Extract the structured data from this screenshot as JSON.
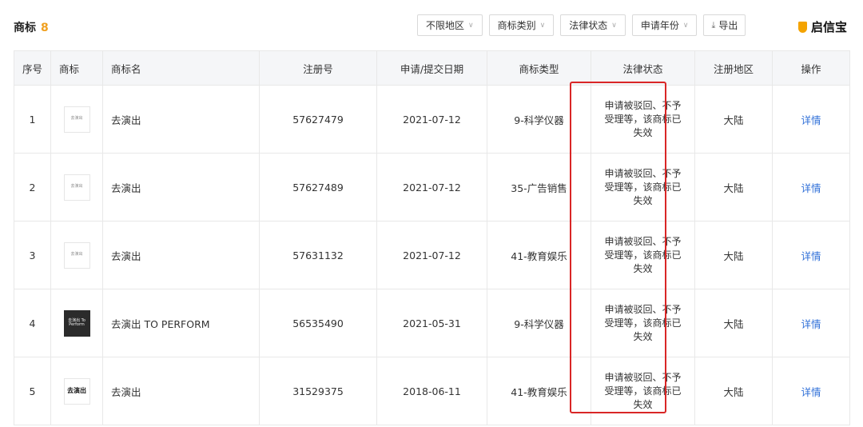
{
  "header": {
    "title": "商标",
    "count": "8",
    "filters": [
      "不限地区",
      "商标类别",
      "法律状态",
      "申请年份"
    ],
    "export_label": "导出",
    "brand_name": "启信宝"
  },
  "table": {
    "columns": [
      "序号",
      "商标",
      "商标名",
      "注册号",
      "申请/提交日期",
      "商标类型",
      "法律状态",
      "注册地区",
      "操作"
    ],
    "rows": [
      {
        "no": "1",
        "logo_text": "去演出",
        "name": "去演出",
        "reg_no": "57627479",
        "date": "2021-07-12",
        "type": "9-科学仪器",
        "status": "申请被驳回、不予受理等，该商标已失效",
        "region": "大陆",
        "action": "详情"
      },
      {
        "no": "2",
        "logo_text": "去演出",
        "name": "去演出",
        "reg_no": "57627489",
        "date": "2021-07-12",
        "type": "35-广告销售",
        "status": "申请被驳回、不予受理等，该商标已失效",
        "region": "大陆",
        "action": "详情"
      },
      {
        "no": "3",
        "logo_text": "去演出",
        "name": "去演出",
        "reg_no": "57631132",
        "date": "2021-07-12",
        "type": "41-教育娱乐",
        "status": "申请被驳回、不予受理等，该商标已失效",
        "region": "大陆",
        "action": "详情"
      },
      {
        "no": "4",
        "logo_text": "去演出 To Perform",
        "name": "去演出 TO PERFORM",
        "reg_no": "56535490",
        "date": "2021-05-31",
        "type": "9-科学仪器",
        "status": "申请被驳回、不予受理等，该商标已失效",
        "region": "大陆",
        "action": "详情"
      },
      {
        "no": "5",
        "logo_text": "去演出",
        "name": "去演出",
        "reg_no": "31529375",
        "date": "2018-06-11",
        "type": "41-教育娱乐",
        "status": "申请被驳回、不予受理等，该商标已失效",
        "region": "大陆",
        "action": "详情"
      }
    ]
  },
  "colors": {
    "accent_count": "#f0a020",
    "link": "#2f6fd8",
    "highlight": "#d92626",
    "header_bg": "#f5f6f8"
  }
}
